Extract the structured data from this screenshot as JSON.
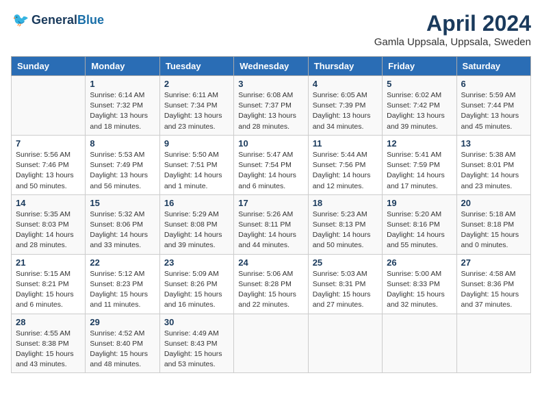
{
  "logo": {
    "line1": "General",
    "line2": "Blue"
  },
  "title": "April 2024",
  "location": "Gamla Uppsala, Uppsala, Sweden",
  "days_of_week": [
    "Sunday",
    "Monday",
    "Tuesday",
    "Wednesday",
    "Thursday",
    "Friday",
    "Saturday"
  ],
  "weeks": [
    [
      {
        "num": "",
        "detail": ""
      },
      {
        "num": "1",
        "detail": "Sunrise: 6:14 AM\nSunset: 7:32 PM\nDaylight: 13 hours\nand 18 minutes."
      },
      {
        "num": "2",
        "detail": "Sunrise: 6:11 AM\nSunset: 7:34 PM\nDaylight: 13 hours\nand 23 minutes."
      },
      {
        "num": "3",
        "detail": "Sunrise: 6:08 AM\nSunset: 7:37 PM\nDaylight: 13 hours\nand 28 minutes."
      },
      {
        "num": "4",
        "detail": "Sunrise: 6:05 AM\nSunset: 7:39 PM\nDaylight: 13 hours\nand 34 minutes."
      },
      {
        "num": "5",
        "detail": "Sunrise: 6:02 AM\nSunset: 7:42 PM\nDaylight: 13 hours\nand 39 minutes."
      },
      {
        "num": "6",
        "detail": "Sunrise: 5:59 AM\nSunset: 7:44 PM\nDaylight: 13 hours\nand 45 minutes."
      }
    ],
    [
      {
        "num": "7",
        "detail": "Sunrise: 5:56 AM\nSunset: 7:46 PM\nDaylight: 13 hours\nand 50 minutes."
      },
      {
        "num": "8",
        "detail": "Sunrise: 5:53 AM\nSunset: 7:49 PM\nDaylight: 13 hours\nand 56 minutes."
      },
      {
        "num": "9",
        "detail": "Sunrise: 5:50 AM\nSunset: 7:51 PM\nDaylight: 14 hours\nand 1 minute."
      },
      {
        "num": "10",
        "detail": "Sunrise: 5:47 AM\nSunset: 7:54 PM\nDaylight: 14 hours\nand 6 minutes."
      },
      {
        "num": "11",
        "detail": "Sunrise: 5:44 AM\nSunset: 7:56 PM\nDaylight: 14 hours\nand 12 minutes."
      },
      {
        "num": "12",
        "detail": "Sunrise: 5:41 AM\nSunset: 7:59 PM\nDaylight: 14 hours\nand 17 minutes."
      },
      {
        "num": "13",
        "detail": "Sunrise: 5:38 AM\nSunset: 8:01 PM\nDaylight: 14 hours\nand 23 minutes."
      }
    ],
    [
      {
        "num": "14",
        "detail": "Sunrise: 5:35 AM\nSunset: 8:03 PM\nDaylight: 14 hours\nand 28 minutes."
      },
      {
        "num": "15",
        "detail": "Sunrise: 5:32 AM\nSunset: 8:06 PM\nDaylight: 14 hours\nand 33 minutes."
      },
      {
        "num": "16",
        "detail": "Sunrise: 5:29 AM\nSunset: 8:08 PM\nDaylight: 14 hours\nand 39 minutes."
      },
      {
        "num": "17",
        "detail": "Sunrise: 5:26 AM\nSunset: 8:11 PM\nDaylight: 14 hours\nand 44 minutes."
      },
      {
        "num": "18",
        "detail": "Sunrise: 5:23 AM\nSunset: 8:13 PM\nDaylight: 14 hours\nand 50 minutes."
      },
      {
        "num": "19",
        "detail": "Sunrise: 5:20 AM\nSunset: 8:16 PM\nDaylight: 14 hours\nand 55 minutes."
      },
      {
        "num": "20",
        "detail": "Sunrise: 5:18 AM\nSunset: 8:18 PM\nDaylight: 15 hours\nand 0 minutes."
      }
    ],
    [
      {
        "num": "21",
        "detail": "Sunrise: 5:15 AM\nSunset: 8:21 PM\nDaylight: 15 hours\nand 6 minutes."
      },
      {
        "num": "22",
        "detail": "Sunrise: 5:12 AM\nSunset: 8:23 PM\nDaylight: 15 hours\nand 11 minutes."
      },
      {
        "num": "23",
        "detail": "Sunrise: 5:09 AM\nSunset: 8:26 PM\nDaylight: 15 hours\nand 16 minutes."
      },
      {
        "num": "24",
        "detail": "Sunrise: 5:06 AM\nSunset: 8:28 PM\nDaylight: 15 hours\nand 22 minutes."
      },
      {
        "num": "25",
        "detail": "Sunrise: 5:03 AM\nSunset: 8:31 PM\nDaylight: 15 hours\nand 27 minutes."
      },
      {
        "num": "26",
        "detail": "Sunrise: 5:00 AM\nSunset: 8:33 PM\nDaylight: 15 hours\nand 32 minutes."
      },
      {
        "num": "27",
        "detail": "Sunrise: 4:58 AM\nSunset: 8:36 PM\nDaylight: 15 hours\nand 37 minutes."
      }
    ],
    [
      {
        "num": "28",
        "detail": "Sunrise: 4:55 AM\nSunset: 8:38 PM\nDaylight: 15 hours\nand 43 minutes."
      },
      {
        "num": "29",
        "detail": "Sunrise: 4:52 AM\nSunset: 8:40 PM\nDaylight: 15 hours\nand 48 minutes."
      },
      {
        "num": "30",
        "detail": "Sunrise: 4:49 AM\nSunset: 8:43 PM\nDaylight: 15 hours\nand 53 minutes."
      },
      {
        "num": "",
        "detail": ""
      },
      {
        "num": "",
        "detail": ""
      },
      {
        "num": "",
        "detail": ""
      },
      {
        "num": "",
        "detail": ""
      }
    ]
  ]
}
